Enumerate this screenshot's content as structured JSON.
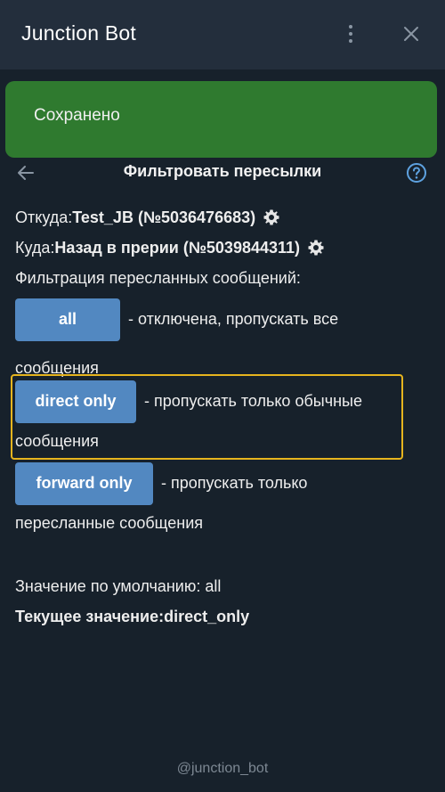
{
  "header": {
    "title": "Junction Bot"
  },
  "toast": {
    "text": "Сохранено",
    "color": "#2f7a2f"
  },
  "page": {
    "title": "Фильтровать пересылки"
  },
  "details": {
    "from_label": "Откуда: ",
    "from_value": "Test_JB (№5036476683)",
    "to_label": "Куда: ",
    "to_value": "Назад в прерии (№5039844311)",
    "filter_heading": "Фильтрация пересланных сообщений:"
  },
  "options": [
    {
      "label": "all",
      "desc_first": " - отключена, пропускать все",
      "desc_rest": "сообщения"
    },
    {
      "label": "direct only",
      "desc_first": " - пропускать только обычные",
      "desc_rest": "сообщения",
      "selected": true
    },
    {
      "label": "forward only",
      "desc_first": " - пропускать только",
      "desc_rest": "пересланные сообщения"
    }
  ],
  "values": {
    "default_text": "Значение по умолчанию: all",
    "current_label": "Текущее значение: ",
    "current_value": "direct_only"
  },
  "footer": {
    "handle": "@junction_bot"
  },
  "colors": {
    "background": "#17212b",
    "header": "#232e3c",
    "button": "#5288c1",
    "highlight": "#e6b41e",
    "accent_icon": "#5ea2e0"
  }
}
